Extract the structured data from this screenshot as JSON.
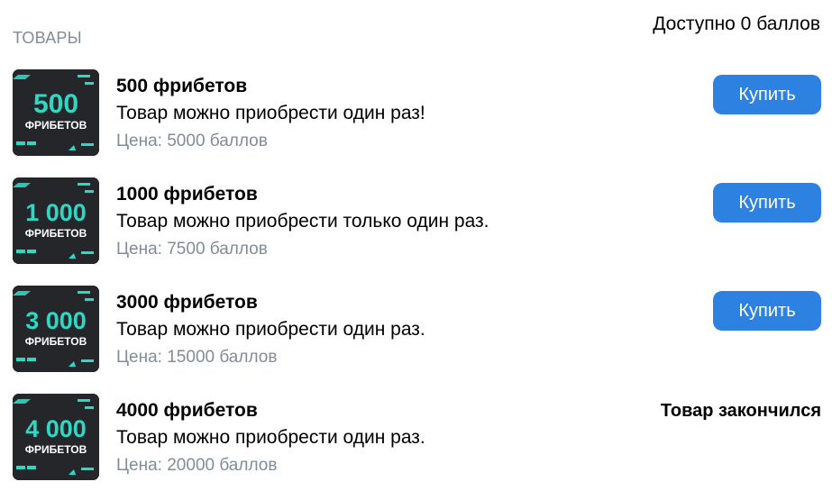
{
  "header": {
    "section_title": "ТОВАРЫ",
    "balance_text": "Доступно 0 баллов"
  },
  "colors": {
    "accent": "#2d81e0",
    "muted_text": "#818c99",
    "thumb_background": "#24262a",
    "thumb_number": "#2fd8c4"
  },
  "products": [
    {
      "thumb_number": "500",
      "thumb_word": "ФРИБЕТОВ",
      "name": "500 фрибетов",
      "description": "Товар можно приобрести один раз!",
      "price": "Цена: 5000 баллов",
      "action_label": "Купить"
    },
    {
      "thumb_number": "1 000",
      "thumb_word": "ФРИБЕТОВ",
      "name": "1000 фрибетов",
      "description": "Товар можно приобрести только один раз.",
      "price": "Цена: 7500 баллов",
      "action_label": "Купить"
    },
    {
      "thumb_number": "3 000",
      "thumb_word": "ФРИБЕТОВ",
      "name": "3000 фрибетов",
      "description": "Товар можно приобрести один раз.",
      "price": "Цена: 15000 баллов",
      "action_label": "Купить"
    },
    {
      "thumb_number": "4 000",
      "thumb_word": "ФРИБЕТОВ",
      "name": "4000 фрибетов",
      "description": "Товар можно приобрести один раз.",
      "price": "Цена: 20000 баллов",
      "status_label": "Товар закончился"
    }
  ]
}
